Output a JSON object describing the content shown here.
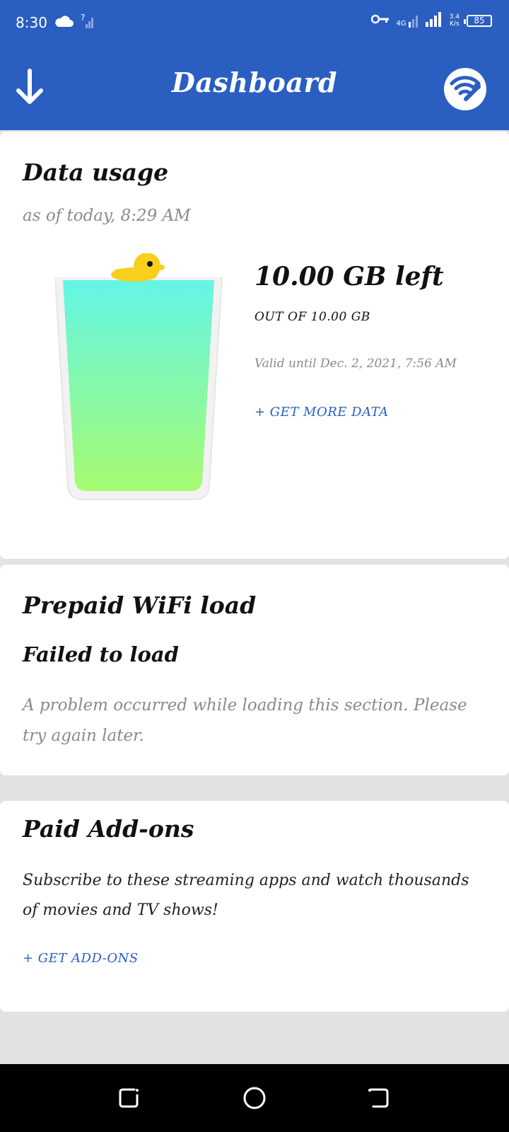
{
  "status_bar": {
    "time": "8:30",
    "network_type": "4G",
    "net_speed_value": "3.4",
    "net_speed_unit": "K/s",
    "battery": "85"
  },
  "app_bar": {
    "title": "Dashboard",
    "back_icon": "arrow-down-icon",
    "action_icon": "wifi-wrench-icon"
  },
  "data_usage": {
    "title": "Data usage",
    "as_of": "as of today, 8:29 AM",
    "remaining": "10.00 GB left",
    "total": "OUT OF 10.00 GB",
    "valid_until": "Valid until Dec. 2, 2021, 7:56 AM",
    "get_more_label": "+ GET MORE DATA",
    "fill_level": 1.0
  },
  "wifi_load": {
    "title": "Prepaid WiFi load",
    "status": "Failed to load",
    "message": "A problem occurred while loading this section. Please try again later."
  },
  "addons": {
    "title": "Paid Add-ons",
    "description": "Subscribe to these streaming apps and watch thousands of movies and TV shows!",
    "get_label": "+ GET ADD-ONS"
  },
  "colors": {
    "primary": "#2a5fc1",
    "background": "#e2e2e2",
    "glass_top": "#63f5e6",
    "glass_bottom": "#a6fb70",
    "duck": "#f8cf1c"
  }
}
